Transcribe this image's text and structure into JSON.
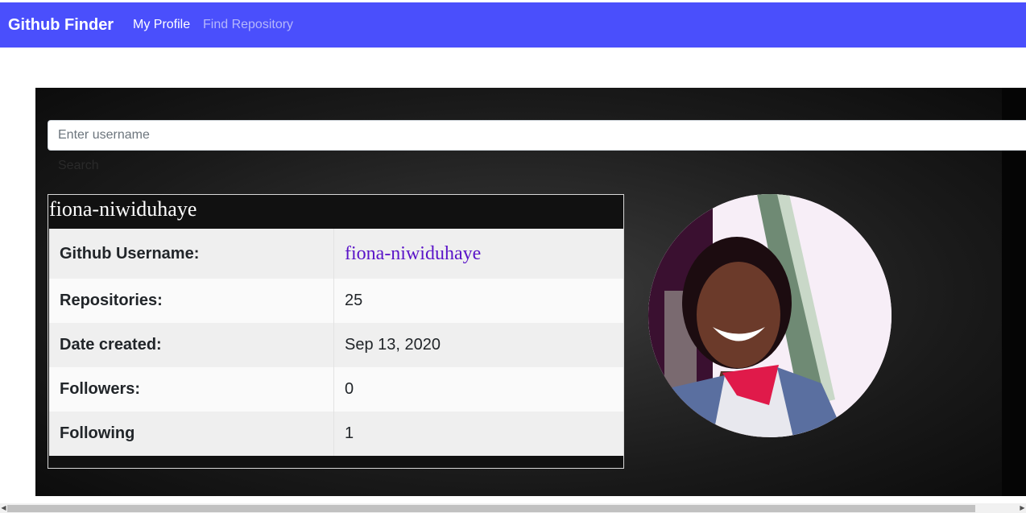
{
  "nav": {
    "brand": "Github Finder",
    "links": [
      "My Profile",
      "Find Repository"
    ]
  },
  "search": {
    "placeholder": "Enter username",
    "button_label": "Search"
  },
  "profile": {
    "title": "fiona-niwiduhaye",
    "rows": [
      {
        "label": "Github Username:",
        "value": "fiona-niwiduhaye"
      },
      {
        "label": "Repositories:",
        "value": "25"
      },
      {
        "label": "Date created:",
        "value": "Sep 13, 2020"
      },
      {
        "label": "Followers:",
        "value": "0"
      },
      {
        "label": "Following",
        "value": "1"
      }
    ]
  },
  "colors": {
    "navbar": "#4a4ffc",
    "link": "#5a14c8",
    "panel": "#1a1a1a"
  },
  "icons": {
    "scroll_left": "scroll-left-arrow-icon",
    "scroll_right": "scroll-right-arrow-icon"
  }
}
